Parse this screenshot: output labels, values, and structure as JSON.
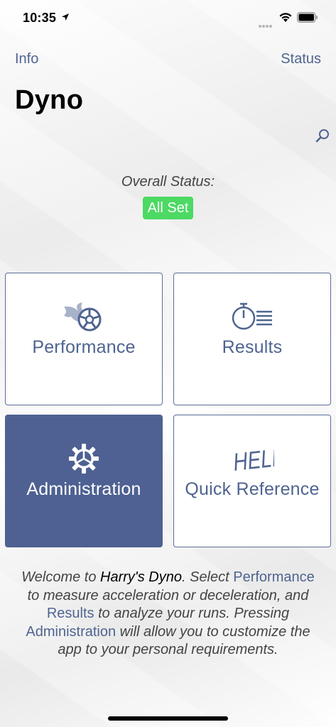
{
  "status_bar": {
    "time": "10:35",
    "icons": [
      "location-arrow-icon",
      "cellular-signal-icon",
      "wifi-icon",
      "battery-icon"
    ]
  },
  "nav": {
    "left_label": "Info",
    "right_label": "Status"
  },
  "page": {
    "title": "Dyno"
  },
  "status": {
    "label": "Overall Status:",
    "badge": "All Set",
    "badge_color": "#4cd964"
  },
  "tiles": [
    {
      "label": "Performance",
      "icon": "wheel-flame-icon"
    },
    {
      "label": "Results",
      "icon": "stopwatch-list-icon"
    },
    {
      "label": "Administration",
      "icon": "gear-icon",
      "selected": true
    },
    {
      "label": "Quick Reference",
      "icon": "help-text-icon",
      "icon_text": "HELP!"
    }
  ],
  "welcome": {
    "p1": "Welcome to ",
    "app_name": "Harry's Dyno",
    "p2": ". Select ",
    "link_performance": "Performance",
    "p3": " to measure acceleration or deceleration, and ",
    "link_results": "Results",
    "p4": " to analyze your runs. Pressing ",
    "link_admin": "Administration",
    "p5": " will allow you to customize the app to your personal requirements."
  },
  "colors": {
    "accent": "#4f6490",
    "selected_tile": "#4e6192",
    "background": "#f6f6f6"
  }
}
